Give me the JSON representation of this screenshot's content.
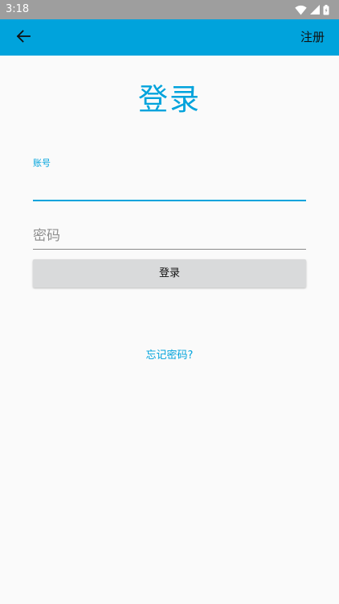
{
  "status_bar": {
    "time": "3:18",
    "icons": [
      "wifi-icon",
      "cell-signal-icon",
      "battery-icon"
    ]
  },
  "toolbar": {
    "back_icon": "arrow-left-icon",
    "action_label": "注册",
    "background": "#00a3dc"
  },
  "page": {
    "title": "登录"
  },
  "form": {
    "account_label": "账号",
    "account_value": "",
    "password_placeholder": "密码",
    "password_value": "",
    "submit_label": "登录",
    "forgot_label": "忘记密码?"
  },
  "colors": {
    "accent": "#00a3dc",
    "button_bg": "#d9dadb",
    "page_bg": "#fafafa"
  }
}
